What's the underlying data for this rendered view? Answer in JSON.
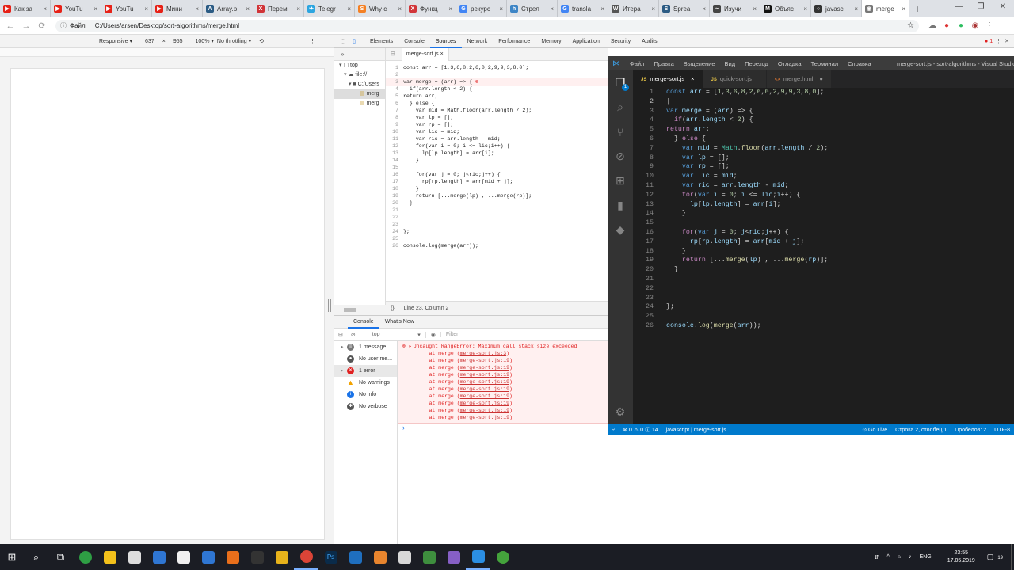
{
  "browser": {
    "tabs": [
      {
        "label": "Как за",
        "color": "#e62117",
        "glyph": "▶"
      },
      {
        "label": "YouTu",
        "color": "#e62117",
        "glyph": "▶"
      },
      {
        "label": "YouTu",
        "color": "#e62117",
        "glyph": "▶"
      },
      {
        "label": "Мини",
        "color": "#e62117",
        "glyph": "▶"
      },
      {
        "label": "Array.p",
        "color": "#2b5b84",
        "glyph": "A"
      },
      {
        "label": "Перем",
        "color": "#d13438",
        "glyph": "X"
      },
      {
        "label": "Telegr",
        "color": "#2ca5e0",
        "glyph": "✈"
      },
      {
        "label": "Why c",
        "color": "#f48024",
        "glyph": "S"
      },
      {
        "label": "Функц",
        "color": "#d13438",
        "glyph": "X"
      },
      {
        "label": "рекурс",
        "color": "#4285f4",
        "glyph": "G"
      },
      {
        "label": "Стрел",
        "color": "#3d85c6",
        "glyph": "h"
      },
      {
        "label": "transla",
        "color": "#4285f4",
        "glyph": "G"
      },
      {
        "label": "Итера",
        "color": "#555555",
        "glyph": "W"
      },
      {
        "label": "Sprea",
        "color": "#2b5b84",
        "glyph": "S"
      },
      {
        "label": "Изучи",
        "color": "#444444",
        "glyph": "~"
      },
      {
        "label": "Объяс",
        "color": "#111111",
        "glyph": "M"
      },
      {
        "label": "javasc",
        "color": "#333333",
        "glyph": "○"
      },
      {
        "label": "merge",
        "color": "#777777",
        "glyph": "◉"
      }
    ],
    "tab_close": "×",
    "new_tab": "+",
    "window_controls": [
      "—",
      "❐",
      "✕"
    ],
    "url_scheme": "Файл",
    "url": "C:/Users/arsen/Desktop/sort-algorithms/merge.html"
  },
  "device_toolbar": {
    "mode": "Responsive ▾",
    "width": "637",
    "times": "×",
    "height": "955",
    "zoom": "100% ▾",
    "throttle": "No throttling ▾"
  },
  "devtools": {
    "tabs": [
      "Elements",
      "Console",
      "Sources",
      "Network",
      "Performance",
      "Memory",
      "Application",
      "Security",
      "Audits"
    ],
    "active_tab": "Sources",
    "error_count": "1",
    "navigator": [
      "top",
      "file://",
      "C:/Users",
      "merg",
      "merg"
    ],
    "open_file": "merge-sort.js",
    "code_lines": [
      "const arr = [1,3,6,8,2,6,0,2,9,9,3,8,0];",
      "",
      "var merge = (arr) => {",
      "  if(arr.length < 2) {",
      "return arr;",
      "  } else {",
      "    var mid = Math.floor(arr.length / 2);",
      "    var lp = [];",
      "    var rp = [];",
      "    var lic = mid;",
      "    var ric = arr.length - mid;",
      "    for(var i = 0; i <= lic;i++) {",
      "      lp[lp.length] = arr[i];",
      "    }",
      "",
      "    for(var j = 0; j<ric;j++) {",
      "      rp[rp.length] = arr[mid + j];",
      "    }",
      "    return [...merge(lp) , ...merge(rp)];",
      "  }",
      "",
      "",
      "",
      "};",
      "",
      "console.log(merge(arr));"
    ],
    "cursor_pos": "Line 23, Column 2",
    "console_tabs": [
      "Console",
      "What's New"
    ],
    "context": "top",
    "filter_placeholder": "Filter",
    "console_sidebar": [
      {
        "label": "1 message",
        "icon": "list-icon",
        "color": "#777777"
      },
      {
        "label": "No user me...",
        "icon": "user-icon",
        "color": "#555555"
      },
      {
        "label": "1 error",
        "icon": "error-icon",
        "color": "#e02020"
      },
      {
        "label": "No warnings",
        "icon": "warning-icon",
        "color": "#f2a200"
      },
      {
        "label": "No info",
        "icon": "info-icon",
        "color": "#1a73e8"
      },
      {
        "label": "No verbose",
        "icon": "bug-icon",
        "color": "#555555"
      }
    ],
    "error_message": "Uncaught RangeError: Maximum call stack size exceeded",
    "stack": [
      {
        "text": "    at merge (",
        "link": "merge-sort.js:3"
      },
      {
        "text": "    at merge (",
        "link": "merge-sort.js:19"
      },
      {
        "text": "    at merge (",
        "link": "merge-sort.js:19"
      },
      {
        "text": "    at merge (",
        "link": "merge-sort.js:19"
      },
      {
        "text": "    at merge (",
        "link": "merge-sort.js:19"
      },
      {
        "text": "    at merge (",
        "link": "merge-sort.js:19"
      },
      {
        "text": "    at merge (",
        "link": "merge-sort.js:19"
      },
      {
        "text": "    at merge (",
        "link": "merge-sort.js:19"
      },
      {
        "text": "    at merge (",
        "link": "merge-sort.js:19"
      },
      {
        "text": "    at merge (",
        "link": "merge-sort.js:19"
      }
    ],
    "prompt": "›"
  },
  "vscode": {
    "menu": [
      "Файл",
      "Правка",
      "Выделение",
      "Вид",
      "Переход",
      "Отладка",
      "Терминал",
      "Справка"
    ],
    "title": "merge-sort.js - sort-algorithms - Visual Studio Code",
    "tabs": [
      {
        "js": "JS",
        "label": "merge-sort.js",
        "mark": "×"
      },
      {
        "js": "JS",
        "label": "quick-sort.js",
        "mark": ""
      },
      {
        "js": "<>",
        "label": "merge.html",
        "mark": "●"
      }
    ],
    "activity_badge": "1",
    "status": {
      "branch_icon": "⑂",
      "problems": "⊗ 0 ⚠ 0 ⓘ 14",
      "language": "javascript | merge-sort.js",
      "golive": "⊙ Go Live",
      "position": "Строка 2, столбец 1",
      "spaces": "Пробелов: 2",
      "encoding": "UTF-8"
    }
  },
  "taskbar": {
    "apps": [
      {
        "name": "search",
        "glyph": "⌕",
        "color": ""
      },
      {
        "name": "task-view",
        "glyph": "⧉",
        "color": ""
      },
      {
        "name": "app-green",
        "glyph": "",
        "color": "#2e9e44"
      },
      {
        "name": "explorer",
        "glyph": "",
        "color": "#f3c11b"
      },
      {
        "name": "app-mail",
        "glyph": "",
        "color": "#dddddd"
      },
      {
        "name": "app-blue",
        "glyph": "",
        "color": "#2f76d2"
      },
      {
        "name": "app-doc",
        "glyph": "",
        "color": "#f0f0f0"
      },
      {
        "name": "app-folder",
        "glyph": "",
        "color": "#2f76d2"
      },
      {
        "name": "app-fire",
        "glyph": "",
        "color": "#e96f1b"
      },
      {
        "name": "app-film",
        "glyph": "",
        "color": "#333333"
      },
      {
        "name": "app-ball",
        "glyph": "",
        "color": "#e8b31b"
      },
      {
        "name": "chrome",
        "glyph": "",
        "color": "#db4437"
      },
      {
        "name": "photoshop",
        "glyph": "Ps",
        "color": "#0a2b4a"
      },
      {
        "name": "app-globe",
        "glyph": "",
        "color": "#1f6fbf"
      },
      {
        "name": "sublime",
        "glyph": "",
        "color": "#e8852e"
      },
      {
        "name": "app-cloud",
        "glyph": "",
        "color": "#d8d8d8"
      },
      {
        "name": "app-hex",
        "glyph": "",
        "color": "#3e8e3e"
      },
      {
        "name": "visual-studio",
        "glyph": "",
        "color": "#865fc5"
      },
      {
        "name": "vscode",
        "glyph": "",
        "color": "#2b8ee3"
      },
      {
        "name": "app-leaf",
        "glyph": "",
        "color": "#44a33c"
      }
    ],
    "tray": [
      "⇵",
      "^",
      "⌂",
      "♪",
      "ENG"
    ],
    "time": "23:55",
    "date": "17.05.2019",
    "notif": "19"
  }
}
